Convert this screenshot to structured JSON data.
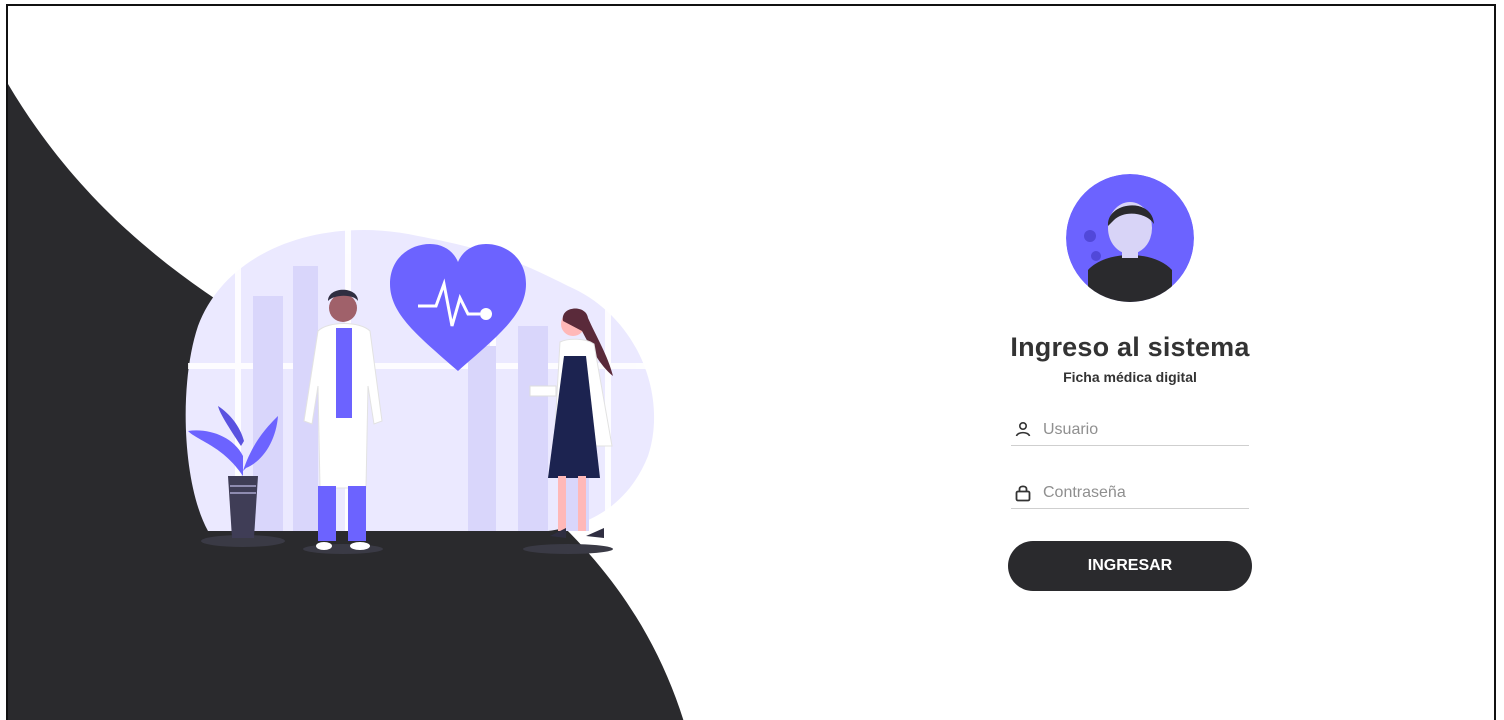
{
  "login": {
    "title": "Ingreso al sistema",
    "subtitle": "Ficha médica digital",
    "username_placeholder": "Usuario",
    "password_placeholder": "Contraseña",
    "submit_label": "INGRESAR"
  },
  "colors": {
    "accent": "#6c63ff",
    "dark": "#2a2a2d",
    "background": "#ffffff"
  },
  "icons": {
    "avatar": "user-avatar-icon",
    "username": "user-icon",
    "password": "lock-icon",
    "heart": "heartbeat-icon"
  }
}
